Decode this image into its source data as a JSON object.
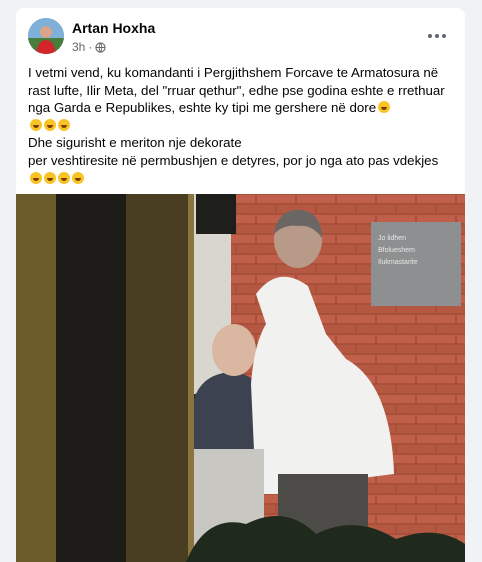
{
  "post": {
    "author": "Artan Hoxha",
    "time": "3h",
    "separator": "·",
    "privacy_icon": "globe-icon",
    "more_icon": "more-dots-icon"
  },
  "content": {
    "line1": "I vetmi vend, ku komandanti i Pergjithshem Forcave te Armatosura në rast lufte, Ilir Meta, del \"rruar qethur\", edhe pse godina eshte e rrethuar nga Garda e Republikes, eshte ky tipi me gershere në dore",
    "line2": "Dhe sigurisht e meriton nje dekorate",
    "line3": "per veshtiresite në permbushjen e detyres, por jo nga ato pas vdekjes"
  },
  "photo_sign": {
    "line1": "Jo lidhen",
    "line2": "Bfolueshem",
    "line3": "Ilukmastarite"
  },
  "colors": {
    "brick": "#b5523a",
    "coat": "#f1f1ef",
    "accent": "#1877f2"
  }
}
